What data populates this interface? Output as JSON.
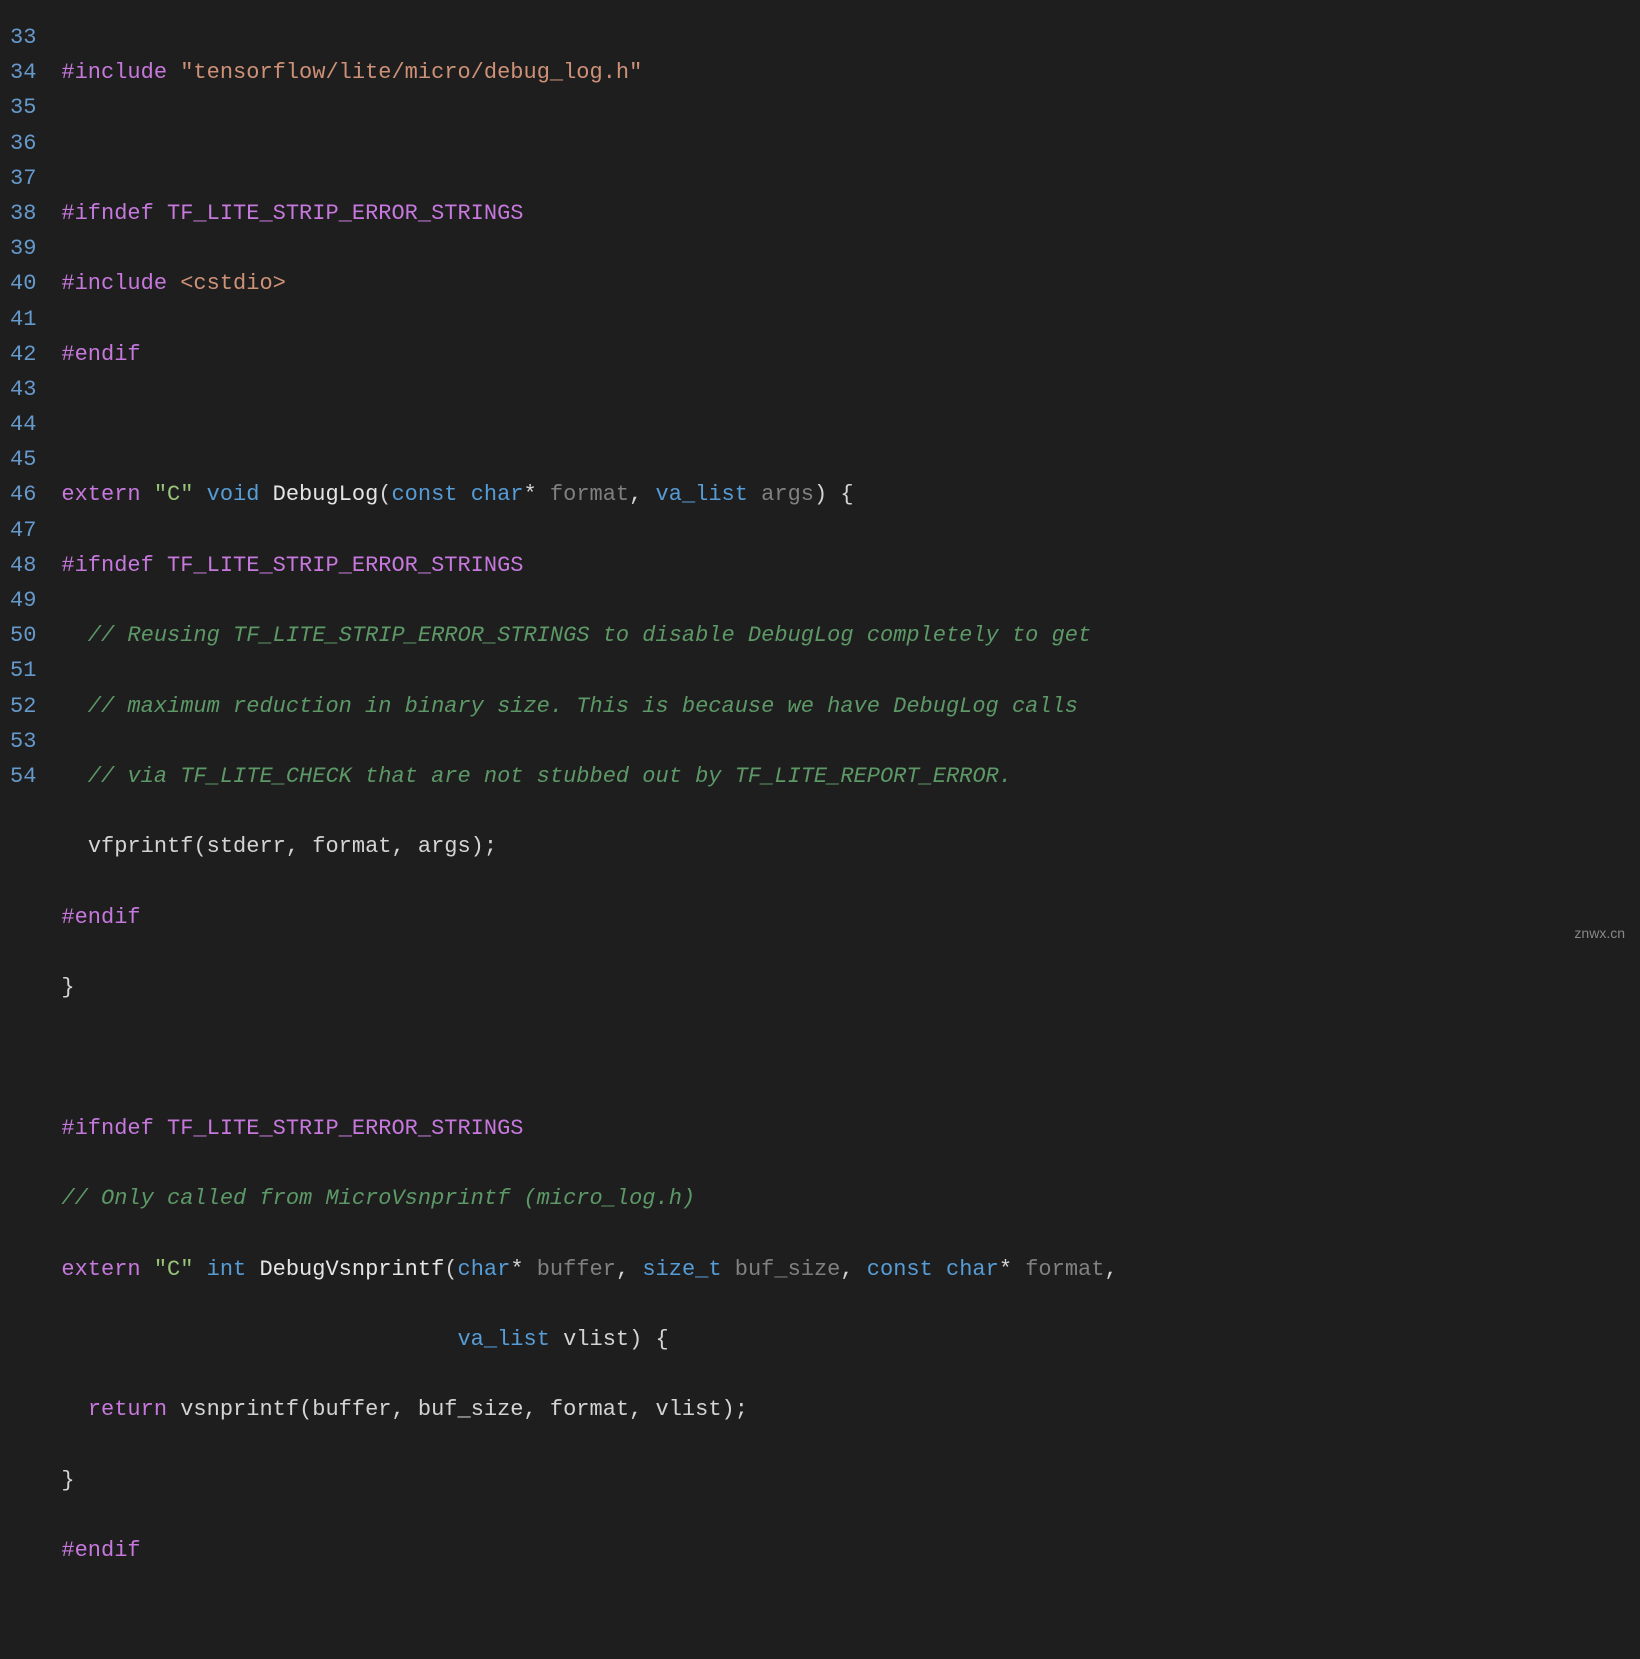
{
  "watermark": "znwx.cn",
  "lines": {
    "n33": "33",
    "n34": "34",
    "n35": "35",
    "n36": "36",
    "n37": "37",
    "n38": "38",
    "n39": "39",
    "n40": "40",
    "n41": "41",
    "n42": "42",
    "n43": "43",
    "n44": "44",
    "n45": "45",
    "n46": "46",
    "n47": "47",
    "n48": "48",
    "n49": "49",
    "n50": "50",
    "n51": "51",
    "n52": "52",
    "n53": "53",
    "n54": "54"
  },
  "code": {
    "l33": {
      "include": "#include",
      "path": "\"tensorflow/lite/micro/debug_log.h\""
    },
    "l35": {
      "ifndef": "#ifndef",
      "macro": "TF_LITE_STRIP_ERROR_STRINGS"
    },
    "l36": {
      "include": "#include",
      "header": "<cstdio>"
    },
    "l37": {
      "endif": "#endif"
    },
    "l39": {
      "extern": "extern",
      "c": "\"C\"",
      "void": "void",
      "fn": "DebugLog",
      "lparen": "(",
      "const1": "const",
      "char1": "char",
      "star1": "*",
      "format": "format",
      "comma": ",",
      "valist": "va_list",
      "args": "args",
      "rparen": ")",
      "lbrace": "{"
    },
    "l40": {
      "ifndef": "#ifndef",
      "macro": "TF_LITE_STRIP_ERROR_STRINGS"
    },
    "l41": {
      "comment": "  // Reusing TF_LITE_STRIP_ERROR_STRINGS to disable DebugLog completely to get"
    },
    "l42": {
      "comment": "  // maximum reduction in binary size. This is because we have DebugLog calls"
    },
    "l43": {
      "comment": "  // via TF_LITE_CHECK that are not stubbed out by TF_LITE_REPORT_ERROR."
    },
    "l44": {
      "indent": "  ",
      "fn": "vfprintf",
      "args": "(stderr, format, args);"
    },
    "l45": {
      "endif": "#endif"
    },
    "l46": {
      "rbrace": "}"
    },
    "l48": {
      "ifndef": "#ifndef",
      "macro": "TF_LITE_STRIP_ERROR_STRINGS"
    },
    "l49": {
      "comment": "// Only called from MicroVsnprintf (micro_log.h)"
    },
    "l50": {
      "extern": "extern",
      "c": "\"C\"",
      "int": "int",
      "fn": "DebugVsnprintf",
      "lparen": "(",
      "char1": "char",
      "star1": "*",
      "buffer": "buffer",
      "comma1": ",",
      "sizet": "size_t",
      "bufsize": "buf_size",
      "comma2": ",",
      "const": "const",
      "char2": "char",
      "star2": "*",
      "format": "format",
      "comma3": ","
    },
    "l51": {
      "indent": "                              ",
      "valist": "va_list",
      "vlist": "vlist",
      "rparen": ")",
      "lbrace": "{"
    },
    "l52": {
      "indent": "  ",
      "return": "return",
      "fn": "vsnprintf",
      "args": "(buffer, buf_size, format, vlist);"
    },
    "l53": {
      "rbrace": "}"
    },
    "l54": {
      "endif": "#endif"
    }
  }
}
